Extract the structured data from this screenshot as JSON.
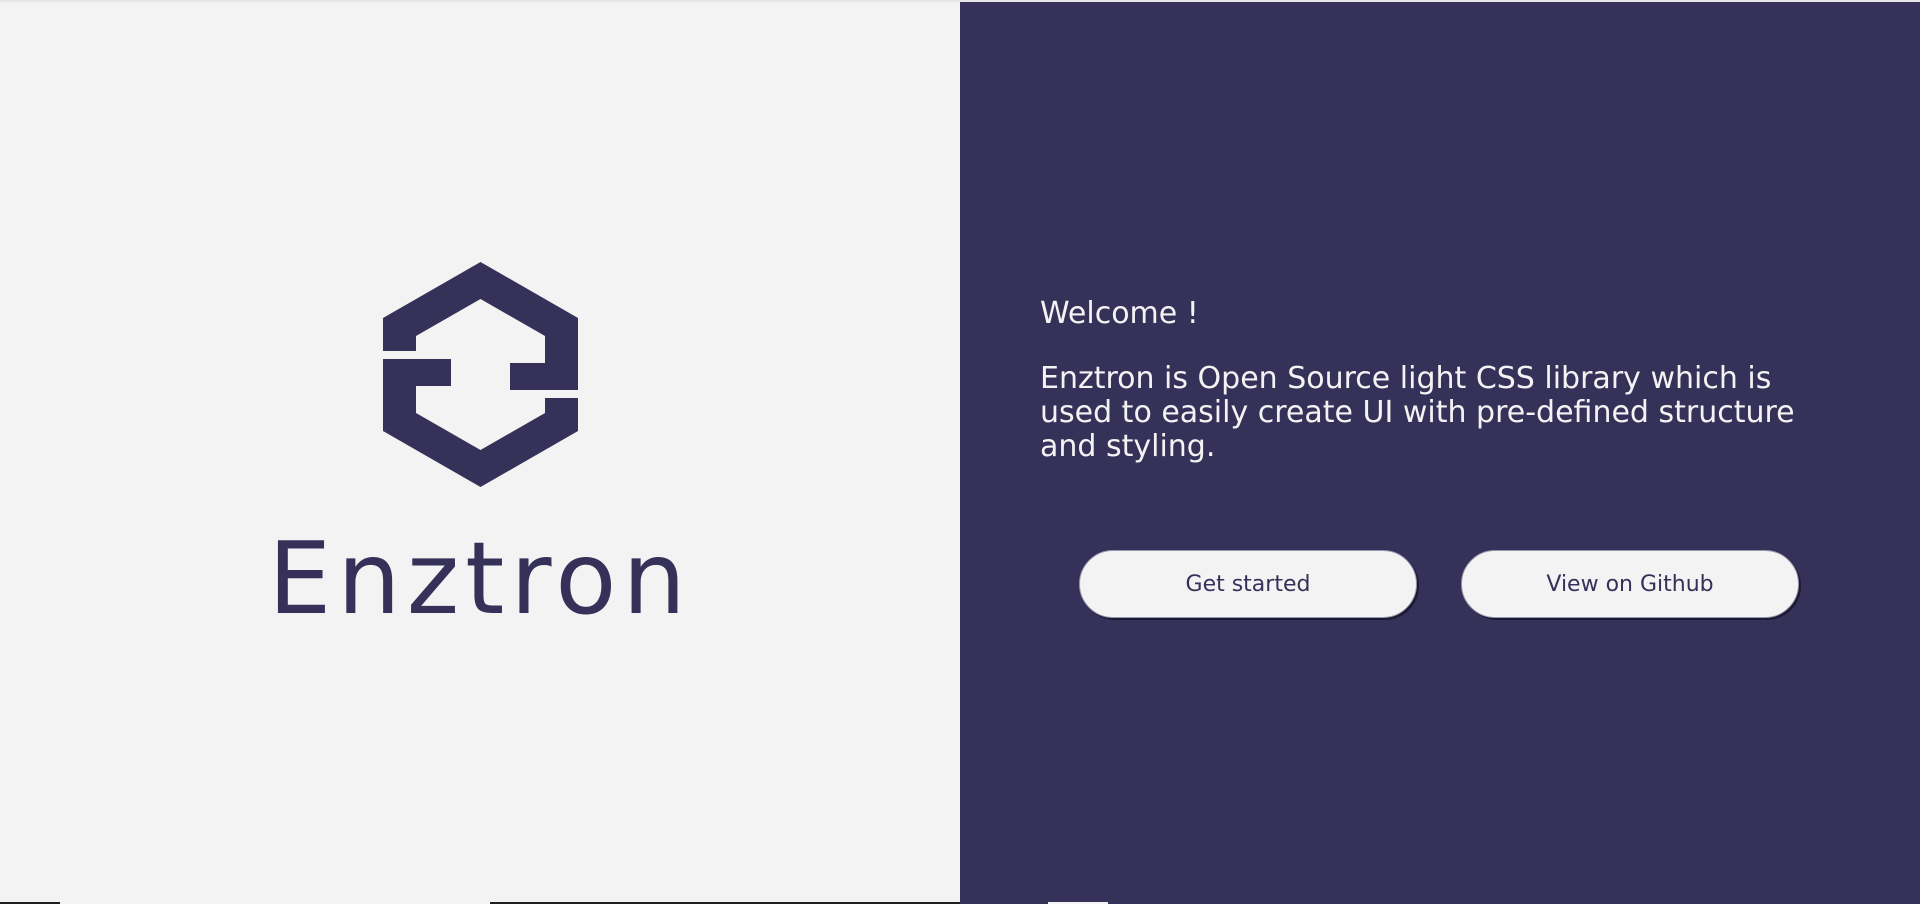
{
  "brand": {
    "name": "Enztron",
    "logo_icon": "enztron-hexagon-logo-icon",
    "color": "#353159"
  },
  "intro": {
    "welcome": "Welcome !",
    "description": "Enztron is Open Source light CSS library which is used to easily create UI with pre-defined structure and styling."
  },
  "actions": {
    "get_started_label": "Get started",
    "github_label": "View on Github"
  },
  "colors": {
    "primary": "#353159",
    "light": "#f3f3f3"
  }
}
